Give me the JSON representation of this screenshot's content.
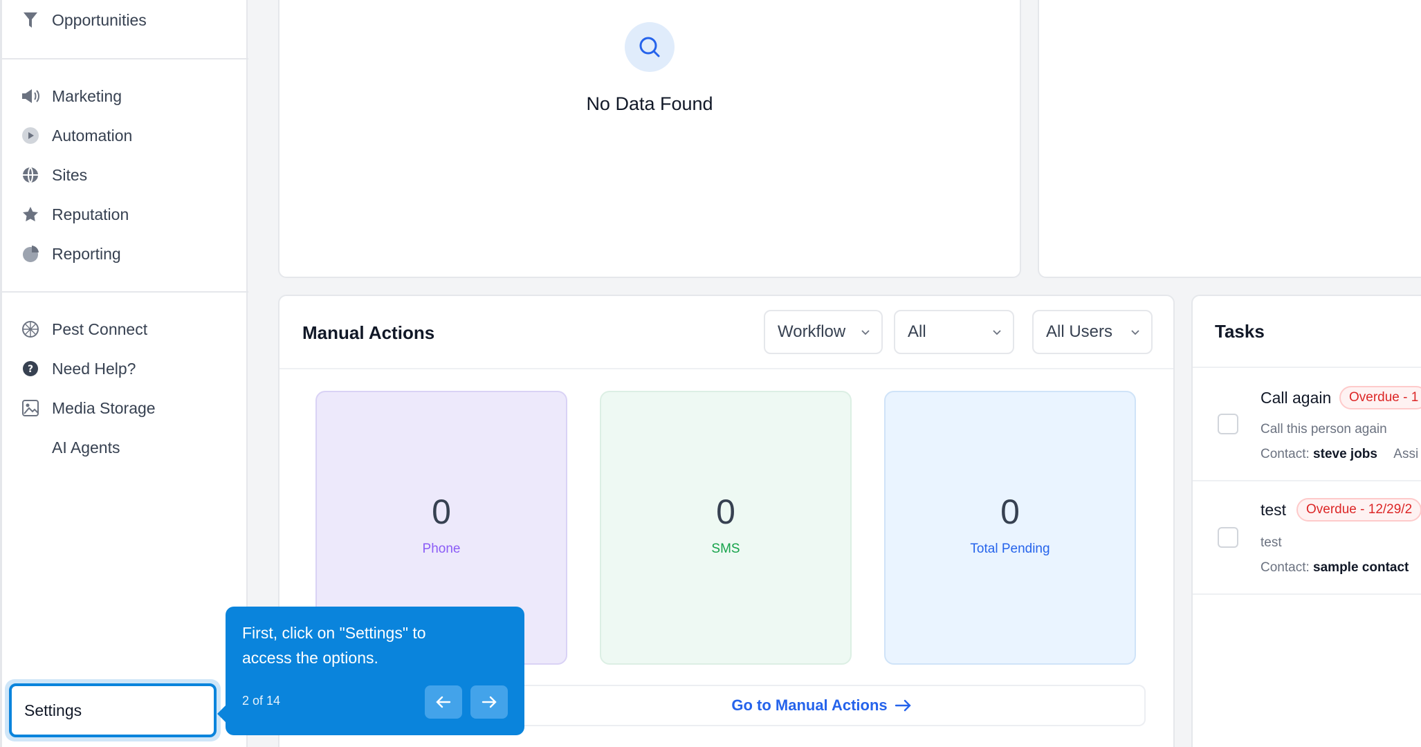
{
  "sidebar": {
    "top_item": {
      "label": "Opportunities",
      "icon": "filter-icon"
    },
    "group1": [
      {
        "label": "Marketing",
        "icon": "megaphone-icon"
      },
      {
        "label": "Automation",
        "icon": "play-circle-icon"
      },
      {
        "label": "Sites",
        "icon": "globe-icon"
      },
      {
        "label": "Reputation",
        "icon": "star-icon"
      },
      {
        "label": "Reporting",
        "icon": "pie-chart-icon"
      }
    ],
    "group2": [
      {
        "label": "Pest Connect",
        "icon": "pest-icon"
      },
      {
        "label": "Need Help?",
        "icon": "help-icon"
      },
      {
        "label": "Media Storage",
        "icon": "image-icon"
      },
      {
        "label": "AI Agents",
        "icon": ""
      }
    ],
    "settings_label": "Settings"
  },
  "empty_card": {
    "message": "No Data Found"
  },
  "manual_actions": {
    "title": "Manual Actions",
    "filters": {
      "type": "Workflow",
      "status": "All",
      "users": "All Users"
    },
    "stats": [
      {
        "value": "0",
        "label": "Phone"
      },
      {
        "value": "0",
        "label": "SMS"
      },
      {
        "value": "0",
        "label": "Total Pending"
      }
    ],
    "goto_label": "Go to Manual Actions"
  },
  "tasks": {
    "title": "Tasks",
    "items": [
      {
        "name": "Call again",
        "badge": "Overdue - 1",
        "description": "Call this person again",
        "contact_label": "Contact:",
        "contact_name": "steve jobs",
        "extra": "Assi"
      },
      {
        "name": "test",
        "badge": "Overdue - 12/29/2",
        "description": "test",
        "contact_label": "Contact:",
        "contact_name": "sample contact",
        "extra": ""
      }
    ]
  },
  "tour": {
    "text": "First, click on \"Settings\" to access the options.",
    "step": "2 of 14"
  },
  "colors": {
    "accent": "#0a84dc",
    "phone_bg": "#ede9fb",
    "sms_bg": "#eef9f3",
    "pending_bg": "#eaf4ff"
  }
}
